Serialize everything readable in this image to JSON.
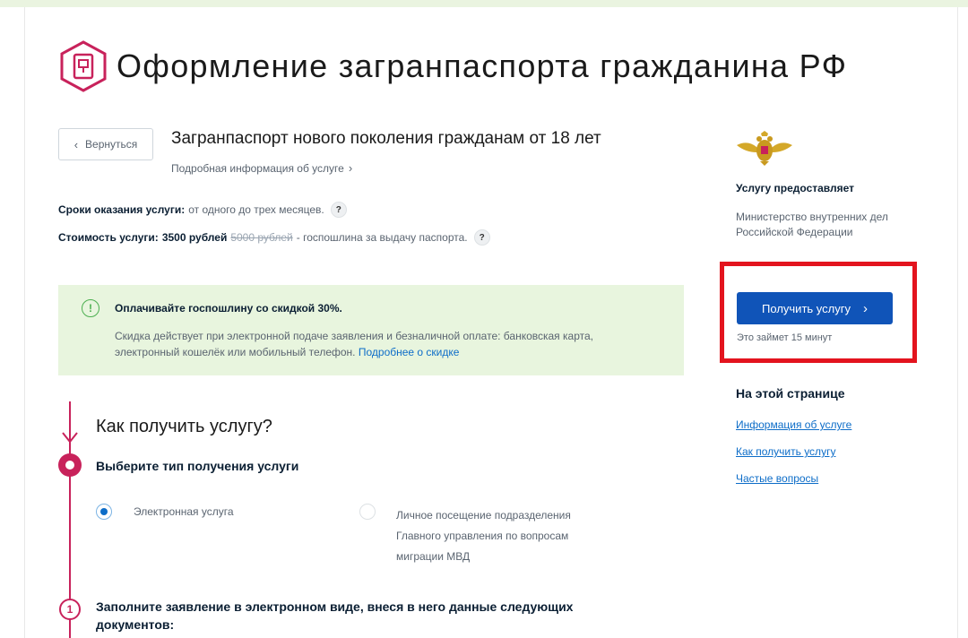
{
  "header": {
    "title": "Оформление загранпаспорта гражданина РФ"
  },
  "back_button": {
    "label": "Вернуться"
  },
  "service": {
    "title": "Загранпаспорт нового поколения гражданам от 18 лет",
    "info_link": "Подробная информация об услуге"
  },
  "terms": {
    "label": "Сроки оказания услуги:",
    "value": "от одного до трех месяцев.",
    "help": "?"
  },
  "cost": {
    "label": "Стоимость услуги:",
    "value": "3500 рублей",
    "old_value": "5000 рублей",
    "suffix": "- госпошлина за выдачу паспорта.",
    "help": "?"
  },
  "promo": {
    "icon": "!",
    "title": "Оплачивайте госпошлину со скидкой 30%.",
    "text": "Скидка действует при электронной подаче заявления и безналичной оплате: банковская карта, электронный кошелёк или мобильный телефон.",
    "link": "Подробнее о скидке"
  },
  "how": {
    "title": "Как получить услугу?",
    "step1_title": "Выберите тип получения услуги",
    "option_electronic": "Электронная услуга",
    "option_visit": "Личное посещение подразделения Главного управления по вопросам миграции МВД",
    "selected_option": "Электронная услуга",
    "step2_number": "1",
    "step2_title": "Заполните заявление в электронном виде, внеся в него данные следующих документов:"
  },
  "sidebar": {
    "provider_label": "Услугу предоставляет",
    "provider_name": "Министерство внутренних дел Российской Федерации",
    "get_button": "Получить услугу",
    "time_note": "Это займет 15 минут",
    "toc_title": "На этой странице",
    "toc_items": [
      "Информация об услуге",
      "Как получить услугу",
      "Частые вопросы"
    ]
  },
  "colors": {
    "accent": "#c8225b",
    "primary_button": "#1054b8",
    "link": "#0d6dc8",
    "promo_bg": "#e8f5de",
    "highlight": "#e3141e"
  },
  "icons": {
    "logo": "passport-hexagon-icon",
    "emblem": "double-headed-eagle-emblem",
    "promo": "exclamation-circle-icon"
  }
}
